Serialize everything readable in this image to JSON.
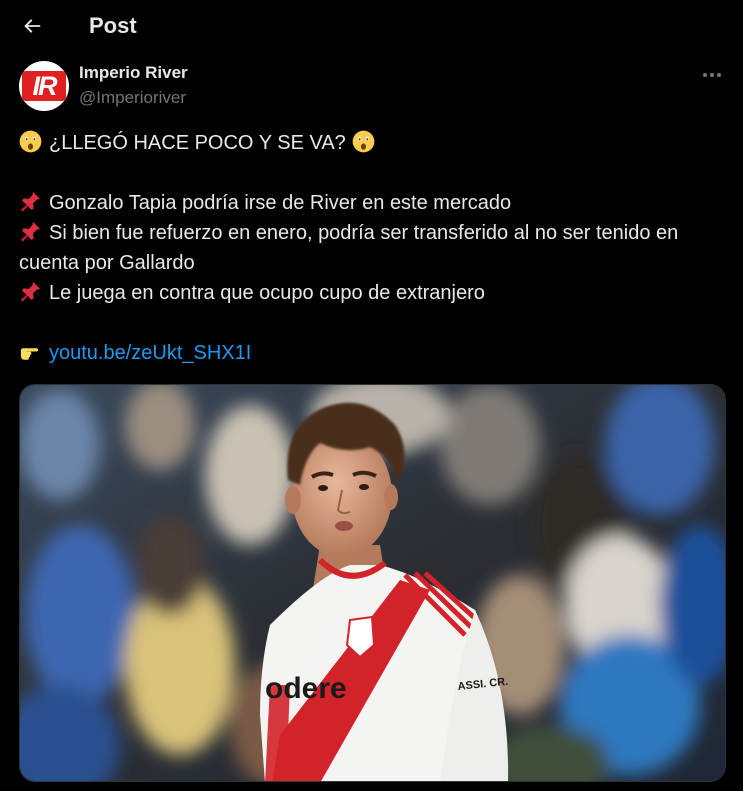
{
  "header": {
    "title": "Post",
    "back_icon": "arrow-left-icon"
  },
  "author": {
    "display_name": "Imperio River",
    "handle": "@Imperioriver",
    "avatar_text": "IR",
    "more_icon": "more-horizontal-icon"
  },
  "tweet": {
    "headline": "¿LLEGÓ HACE POCO Y SE VA?",
    "headline_emoji": "astonished-face-icon",
    "bullets": [
      "Gonzalo Tapia podría irse de River en este mercado",
      "Si bien fue refuerzo en enero, podría ser transferido al no ser tenido en cuenta por Gallardo",
      "Le juega en contra que ocupo cupo de extranjero"
    ],
    "bullet_emoji": "pushpin-icon",
    "link_emoji": "pointing-hand-icon",
    "link_text": "youtu.be/zeUkt_SHX1I"
  },
  "media": {
    "jersey_text": "odere",
    "jersey_brand": "ASSI. CR."
  },
  "colors": {
    "background": "#000000",
    "text": "#e7e9ea",
    "muted": "#71767b",
    "link": "#1d9bf0",
    "brand_red": "#e02020"
  }
}
